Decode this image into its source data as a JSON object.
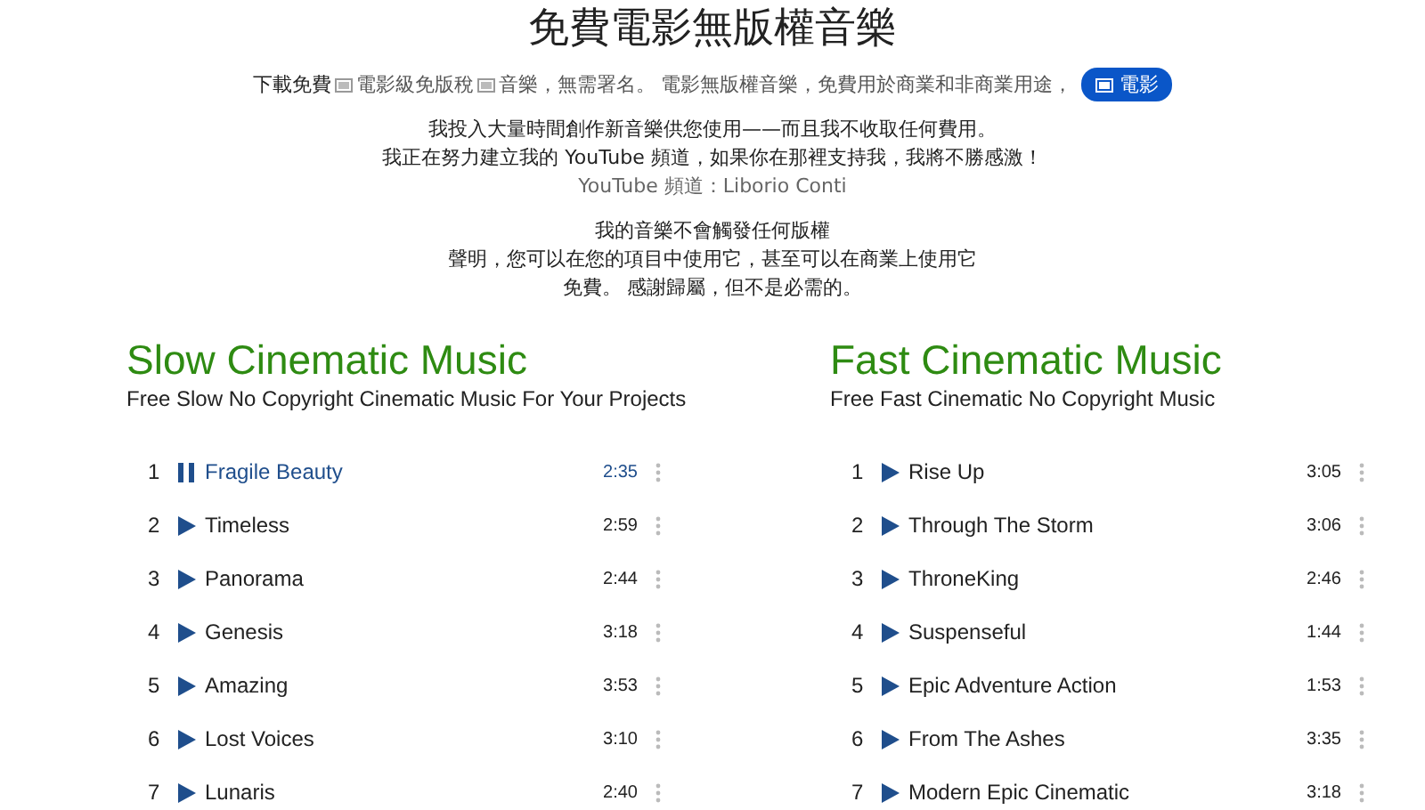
{
  "title": "免費電影無版權音樂",
  "intro": [
    {
      "kind": "text",
      "text": "下載免費"
    },
    {
      "kind": "linked",
      "text": "電影級免版稅"
    },
    {
      "kind": "linked",
      "text": "音樂，無需署名。 電影無版權音樂，免費用於商業和非商業用途，"
    }
  ],
  "badge": {
    "text": "電影"
  },
  "paragraphs": [
    {
      "lines": [
        {
          "text": "我投入大量時間創作新音樂供您使用——而且我不收取任何費用。",
          "muted": false
        },
        {
          "text": "我正在努力建立我的 YouTube 頻道，如果你在那裡支持我，我將不勝感激！",
          "muted": false
        },
        {
          "text": "YouTube 頻道：Liborio Conti",
          "muted": true
        }
      ]
    },
    {
      "lines": [
        {
          "text": "我的音樂不會觸發任何版權",
          "muted": false
        },
        {
          "text": "聲明，您可以在您的項目中使用它，甚至可以在商業上使用它",
          "muted": false
        },
        {
          "text": "免費。 感謝歸屬，但不是必需的。",
          "muted": false
        }
      ]
    }
  ],
  "playlists": [
    {
      "title": "Slow Cinematic Music",
      "subtitle": "Free Slow No Copyright Cinematic Music For Your Projects",
      "tracks": [
        {
          "number": "1",
          "title": "Fragile Beauty",
          "duration": "2:35",
          "playing": true
        },
        {
          "number": "2",
          "title": "Timeless",
          "duration": "2:59",
          "playing": false
        },
        {
          "number": "3",
          "title": "Panorama",
          "duration": "2:44",
          "playing": false
        },
        {
          "number": "4",
          "title": "Genesis",
          "duration": "3:18",
          "playing": false
        },
        {
          "number": "5",
          "title": "Amazing",
          "duration": "3:53",
          "playing": false
        },
        {
          "number": "6",
          "title": "Lost Voices",
          "duration": "3:10",
          "playing": false
        },
        {
          "number": "7",
          "title": "Lunaris",
          "duration": "2:40",
          "playing": false
        }
      ]
    },
    {
      "title": "Fast Cinematic Music",
      "subtitle": "Free Fast Cinematic No Copyright Music",
      "tracks": [
        {
          "number": "1",
          "title": "Rise Up",
          "duration": "3:05",
          "playing": false
        },
        {
          "number": "2",
          "title": "Through The Storm",
          "duration": "3:06",
          "playing": false
        },
        {
          "number": "3",
          "title": "ThroneKing",
          "duration": "2:46",
          "playing": false
        },
        {
          "number": "4",
          "title": "Suspenseful",
          "duration": "1:44",
          "playing": false
        },
        {
          "number": "5",
          "title": "Epic Adventure Action",
          "duration": "1:53",
          "playing": false
        },
        {
          "number": "6",
          "title": "From The Ashes",
          "duration": "3:35",
          "playing": false
        },
        {
          "number": "7",
          "title": "Modern Epic Cinematic",
          "duration": "3:18",
          "playing": false
        }
      ]
    }
  ]
}
